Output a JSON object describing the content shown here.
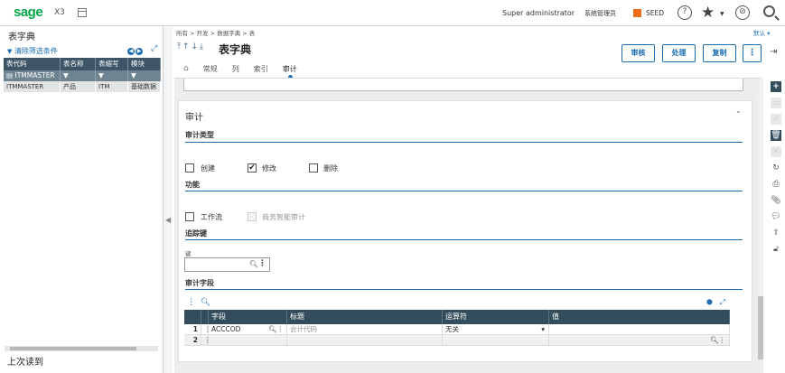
{
  "topbar": {
    "logo": "sage",
    "product": "X3",
    "user": "Super administrator",
    "admin": "系统管理员",
    "folder": "SEED",
    "help_icon": "?",
    "compass_icon": "⊘"
  },
  "left": {
    "title": "表字典",
    "clear_filter": "清除筛选条件",
    "columns": [
      "表代码",
      "表名称",
      "表缩写",
      "模块"
    ],
    "group": "ITMMASTER",
    "rows": [
      {
        "code": "ITMMASTER",
        "name": "产品",
        "abbr": "ITM",
        "module": "基础数据"
      }
    ],
    "footer": "上次读到"
  },
  "breadcrumb": [
    "所有",
    "开发",
    "数据字典",
    "表"
  ],
  "default_label": "默认",
  "header": {
    "title": "表字典",
    "buttons": {
      "audit": "审核",
      "process": "处理",
      "copy": "复制"
    }
  },
  "tabs": [
    "常规",
    "列",
    "索引",
    "审计"
  ],
  "card": {
    "title": "审计",
    "audit_type": {
      "label": "审计类型",
      "create": "创建",
      "create_checked": false,
      "modify": "修改",
      "modify_checked": true,
      "delete": "删除",
      "delete_checked": false
    },
    "function": {
      "label": "功能",
      "workflow": "工作流",
      "bi": "商务智能审计"
    },
    "tracking_key": {
      "label": "追踪键",
      "field_label": "键",
      "value": ""
    },
    "audit_fields": {
      "label": "审计字段",
      "columns": [
        "字段",
        "标题",
        "运算符",
        "值"
      ],
      "rows": [
        {
          "num": "1",
          "field": "ACCCOD",
          "title": "会计代码",
          "operator": "无关",
          "value": ""
        },
        {
          "num": "2",
          "field": "",
          "title": "",
          "operator": "",
          "value": ""
        }
      ]
    }
  }
}
